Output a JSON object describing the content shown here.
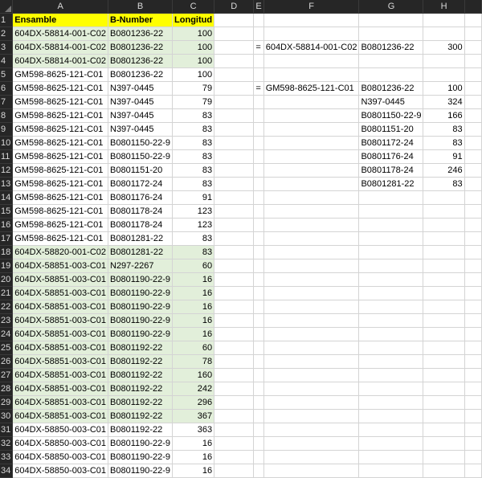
{
  "columns": [
    "A",
    "B",
    "C",
    "D",
    "E",
    "F",
    "G",
    "H",
    ""
  ],
  "headers": {
    "a": "Ensamble",
    "b": "B-Number",
    "c": "Longitud"
  },
  "rows": [
    {
      "a": "604DX-58814-001-C02",
      "b": "B0801236-22",
      "c": "100",
      "green": true,
      "e": "",
      "f": "",
      "g": "",
      "h": ""
    },
    {
      "a": "604DX-58814-001-C02",
      "b": "B0801236-22",
      "c": "100",
      "green": true,
      "e": "=",
      "f": "604DX-58814-001-C02",
      "g": "B0801236-22",
      "h": "300"
    },
    {
      "a": "604DX-58814-001-C02",
      "b": "B0801236-22",
      "c": "100",
      "green": true
    },
    {
      "a": "GM598-8625-121-C01",
      "b": "B0801236-22",
      "c": "100"
    },
    {
      "a": "GM598-8625-121-C01",
      "b": "N397-0445",
      "c": "79",
      "e": "=",
      "f": "GM598-8625-121-C01",
      "g": "B0801236-22",
      "h": "100"
    },
    {
      "a": "GM598-8625-121-C01",
      "b": "N397-0445",
      "c": "79",
      "g": "N397-0445",
      "h": "324"
    },
    {
      "a": "GM598-8625-121-C01",
      "b": "N397-0445",
      "c": "83",
      "g": "B0801150-22-9",
      "h": "166"
    },
    {
      "a": "GM598-8625-121-C01",
      "b": "N397-0445",
      "c": "83",
      "g": "B0801151-20",
      "h": "83"
    },
    {
      "a": "GM598-8625-121-C01",
      "b": "B0801150-22-9",
      "c": "83",
      "g": "B0801172-24",
      "h": "83"
    },
    {
      "a": "GM598-8625-121-C01",
      "b": "B0801150-22-9",
      "c": "83",
      "g": "B0801176-24",
      "h": "91"
    },
    {
      "a": "GM598-8625-121-C01",
      "b": "B0801151-20",
      "c": "83",
      "g": "B0801178-24",
      "h": "246"
    },
    {
      "a": "GM598-8625-121-C01",
      "b": "B0801172-24",
      "c": "83",
      "g": "B0801281-22",
      "h": "83"
    },
    {
      "a": "GM598-8625-121-C01",
      "b": "B0801176-24",
      "c": "91"
    },
    {
      "a": "GM598-8625-121-C01",
      "b": "B0801178-24",
      "c": "123"
    },
    {
      "a": "GM598-8625-121-C01",
      "b": "B0801178-24",
      "c": "123"
    },
    {
      "a": "GM598-8625-121-C01",
      "b": "B0801281-22",
      "c": "83"
    },
    {
      "a": "604DX-58820-001-C02",
      "b": "B0801281-22",
      "c": "83",
      "green": true
    },
    {
      "a": "604DX-58851-003-C01",
      "b": "N297-2267",
      "c": "60",
      "green": true
    },
    {
      "a": "604DX-58851-003-C01",
      "b": "B0801190-22-9",
      "c": "16",
      "green": true
    },
    {
      "a": "604DX-58851-003-C01",
      "b": "B0801190-22-9",
      "c": "16",
      "green": true
    },
    {
      "a": "604DX-58851-003-C01",
      "b": "B0801190-22-9",
      "c": "16",
      "green": true
    },
    {
      "a": "604DX-58851-003-C01",
      "b": "B0801190-22-9",
      "c": "16",
      "green": true
    },
    {
      "a": "604DX-58851-003-C01",
      "b": "B0801190-22-9",
      "c": "16",
      "green": true
    },
    {
      "a": "604DX-58851-003-C01",
      "b": "B0801192-22",
      "c": "60",
      "green": true
    },
    {
      "a": "604DX-58851-003-C01",
      "b": "B0801192-22",
      "c": "78",
      "green": true
    },
    {
      "a": "604DX-58851-003-C01",
      "b": "B0801192-22",
      "c": "160",
      "green": true
    },
    {
      "a": "604DX-58851-003-C01",
      "b": "B0801192-22",
      "c": "242",
      "green": true
    },
    {
      "a": "604DX-58851-003-C01",
      "b": "B0801192-22",
      "c": "296",
      "green": true
    },
    {
      "a": "604DX-58851-003-C01",
      "b": "B0801192-22",
      "c": "367",
      "green": true
    },
    {
      "a": "604DX-58850-003-C01",
      "b": "B0801192-22",
      "c": "363"
    },
    {
      "a": "604DX-58850-003-C01",
      "b": "B0801190-22-9",
      "c": "16"
    },
    {
      "a": "604DX-58850-003-C01",
      "b": "B0801190-22-9",
      "c": "16"
    },
    {
      "a": "604DX-58850-003-C01",
      "b": "B0801190-22-9",
      "c": "16"
    }
  ]
}
